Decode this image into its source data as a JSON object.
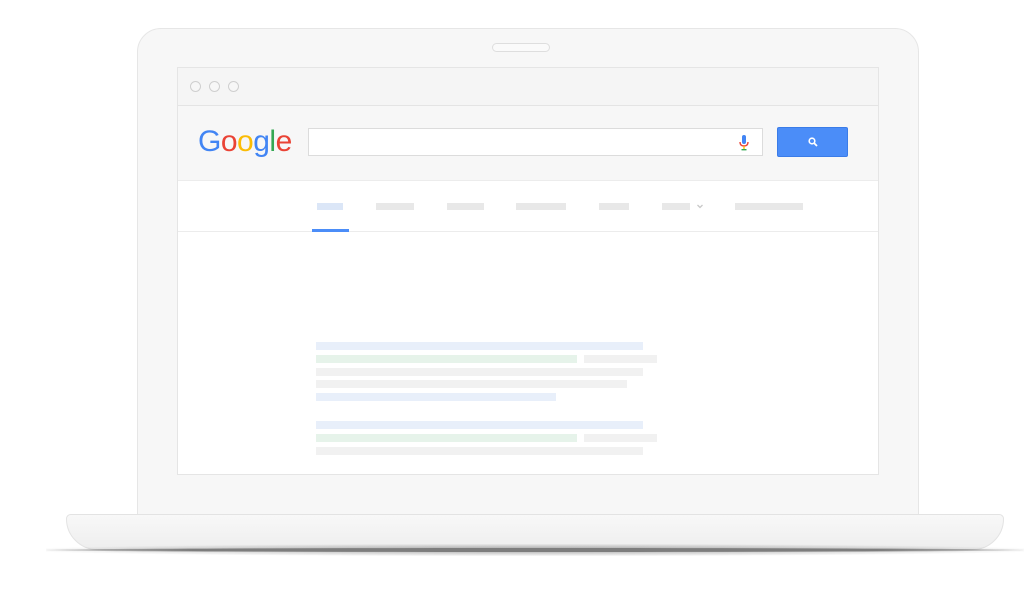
{
  "logo": {
    "letters": [
      "G",
      "o",
      "o",
      "g",
      "l",
      "e"
    ],
    "colors": [
      "#4285F4",
      "#EA4335",
      "#FBBC05",
      "#4285F4",
      "#34A853",
      "#EA4335"
    ]
  },
  "search": {
    "value": "",
    "placeholder": ""
  },
  "icons": {
    "mic": "microphone-icon",
    "search": "search-icon",
    "caret": "chevron-down-icon"
  },
  "colors": {
    "accent": "#4b8df8",
    "result_title": "#e8effa",
    "result_url": "#e6f3ea",
    "result_text": "#f1f1f1"
  }
}
